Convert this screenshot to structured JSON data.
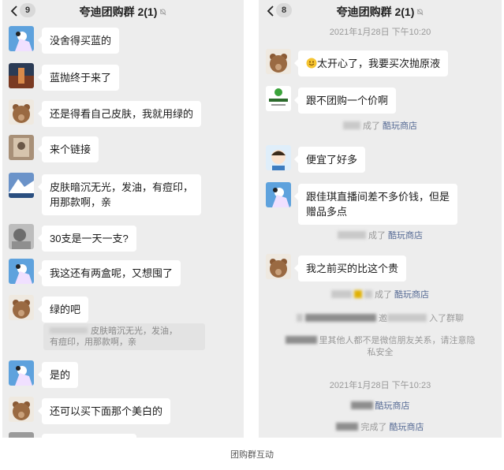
{
  "left": {
    "unread": "9",
    "title": "夸迪团购群 2(1)",
    "messages": [
      "没舍得买蓝的",
      "蓝抛终于来了",
      "还是得看自己皮肤，我就用绿的",
      "来个链接",
      "皮肤暗沉无光，发油，有痘印，",
      "用那款啊，亲",
      "30支是一天一支?",
      "我这还有两盒呢，又想囤了",
      "绿的吧",
      "是的",
      "还可以买下面那个美白的"
    ],
    "quote_line1": "皮肤暗沉无光，发油，",
    "quote_line2": "有痘印，用那款啊，亲"
  },
  "right": {
    "unread": "8",
    "title": "夸迪团购群 2(1)",
    "time1": "2021年1月28日 下午10:20",
    "msg_happy": "太开心了，我要买次抛原液",
    "msg_group_price": "跟不团购一个价啊",
    "sys_completed_1": "成了",
    "link_store_1": "酷玩商店",
    "msg_cheap": "便宜了好多",
    "msg_jiaqi_1": "跟佳琪直播间差不多价钱，但是",
    "msg_jiaqi_2": "赠品多点",
    "sys_completed_2": "成了",
    "link_store_2": "酷玩商店",
    "msg_expensive": "我之前买的比这个贵",
    "sys_completed_3": "成了",
    "link_store_3": "酷玩商店",
    "sys_invite_a": "邀",
    "sys_invite_b": "入了群聊",
    "sys_privacy_1": "里其他人都不是微信朋友关系，请注意隐",
    "sys_privacy_2": "私安全",
    "time2": "2021年1月28日 下午10:23",
    "link_store_4": "酷玩商店",
    "sys_completed_5": "完成了",
    "link_store_5": "酷玩商店"
  },
  "caption": "团购群互动",
  "icons": [
    "back-chevron-icon",
    "mute-bell-icon",
    "happy-emoji-icon"
  ]
}
